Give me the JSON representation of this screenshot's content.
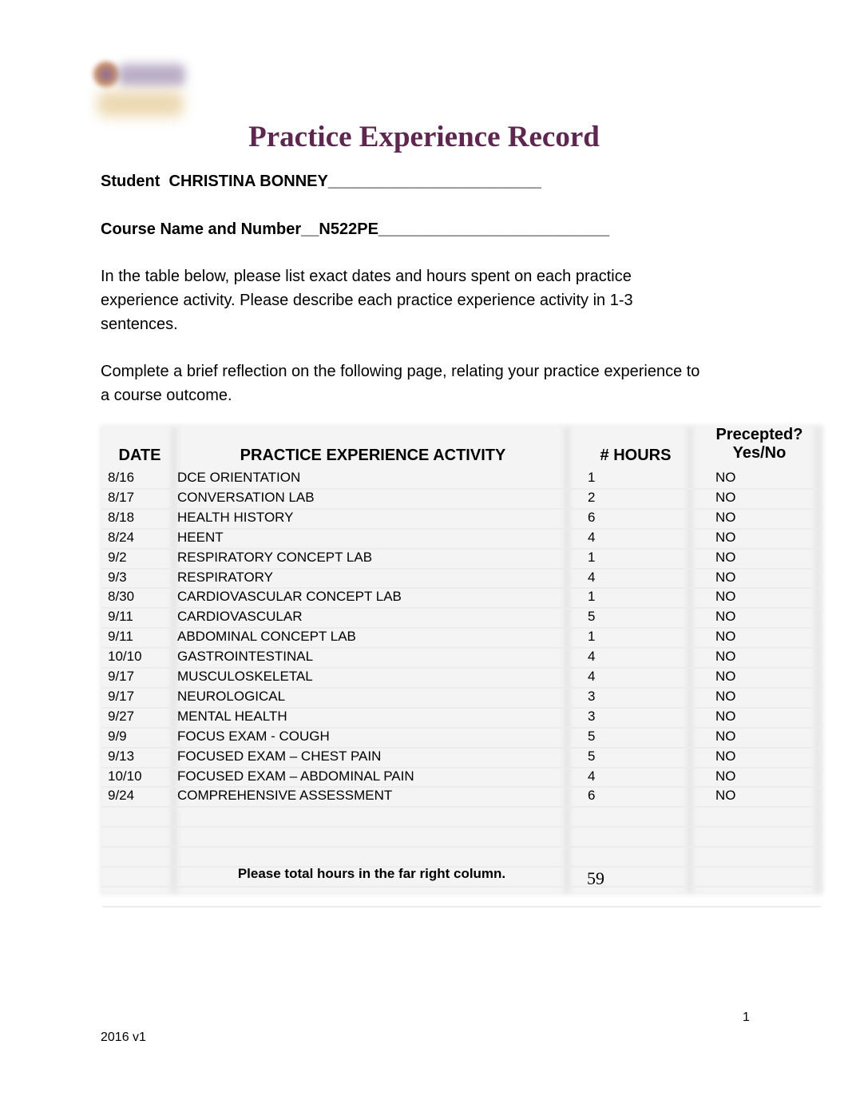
{
  "header": {
    "logo": "institution-logo",
    "title": "Practice Experience Record",
    "title_color": "#5e2750"
  },
  "student_line": "Student  CHRISTINA BONNEY________________________",
  "course_line": "Course Name and Number__N522PE__________________________",
  "instructions": [
    "In the table below, please list exact dates and hours spent on each practice experience activity.  Please describe each practice experience activity in 1-3 sentences.",
    "Complete a brief reflection on the following page, relating your practice experience to a course outcome."
  ],
  "table": {
    "headers": {
      "date": "DATE",
      "activity": "PRACTICE EXPERIENCE ACTIVITY",
      "hours": "# HOURS",
      "precepted_1": "Precepted?",
      "precepted_2": "Yes/No"
    },
    "rows": [
      {
        "date": "8/16",
        "activity": "DCE ORIENTATION",
        "hours": "1",
        "precepted": "NO"
      },
      {
        "date": "8/17",
        "activity": "CONVERSATION LAB",
        "hours": "2",
        "precepted": "NO"
      },
      {
        "date": "8/18",
        "activity": "HEALTH HISTORY",
        "hours": "6",
        "precepted": "NO"
      },
      {
        "date": "8/24",
        "activity": "HEENT",
        "hours": "4",
        "precepted": "NO"
      },
      {
        "date": "9/2",
        "activity": "RESPIRATORY CONCEPT LAB",
        "hours": "1",
        "precepted": "NO"
      },
      {
        "date": "9/3",
        "activity": "RESPIRATORY",
        "hours": "4",
        "precepted": "NO"
      },
      {
        "date": "8/30",
        "activity": "CARDIOVASCULAR CONCEPT LAB",
        "hours": "1",
        "precepted": "NO"
      },
      {
        "date": "9/11",
        "activity": "CARDIOVASCULAR",
        "hours": "5",
        "precepted": "NO"
      },
      {
        "date": "9/11",
        "activity": "ABDOMINAL CONCEPT LAB",
        "hours": "1",
        "precepted": "NO"
      },
      {
        "date": "10/10",
        "activity": "GASTROINTESTINAL",
        "hours": "4",
        "precepted": "NO"
      },
      {
        "date": "9/17",
        "activity": "MUSCULOSKELETAL",
        "hours": "4",
        "precepted": "NO"
      },
      {
        "date": "9/17",
        "activity": "NEUROLOGICAL",
        "hours": "3",
        "precepted": "NO"
      },
      {
        "date": "9/27",
        "activity": "MENTAL HEALTH",
        "hours": "3",
        "precepted": "NO"
      },
      {
        "date": "9/9",
        "activity": "FOCUS EXAM - COUGH",
        "hours": "5",
        "precepted": "NO"
      },
      {
        "date": "9/13",
        "activity": "FOCUSED EXAM – CHEST PAIN",
        "hours": "5",
        "precepted": "NO"
      },
      {
        "date": "10/10",
        "activity": "FOCUSED EXAM – ABDOMINAL PAIN",
        "hours": "4",
        "precepted": "NO"
      },
      {
        "date": "9/24",
        "activity": "COMPREHENSIVE ASSESSMENT",
        "hours": "6",
        "precepted": "NO"
      }
    ],
    "total_label": "Please total hours in the far right column.",
    "total_hours": "59"
  },
  "footer": {
    "page_number": "1",
    "version": "2016 v1"
  }
}
